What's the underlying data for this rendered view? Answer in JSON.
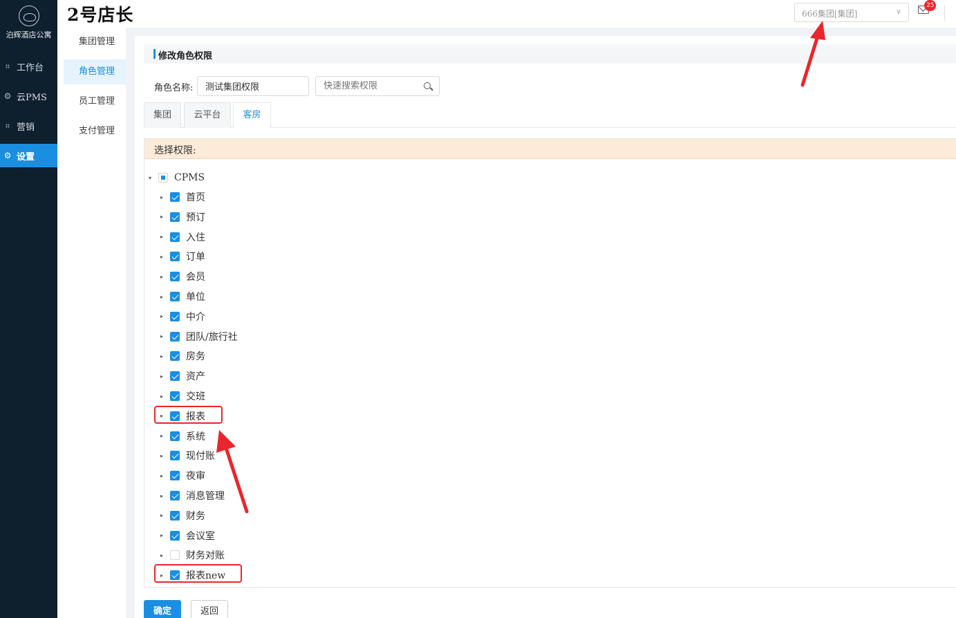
{
  "logo": {
    "text": "泊辉酒店公寓"
  },
  "app_title": "2号店长",
  "nav": [
    {
      "label": "工作台",
      "icon": "workspace-icon"
    },
    {
      "label": "云PMS",
      "icon": "gear-icon"
    },
    {
      "label": "营销",
      "icon": "marketing-icon"
    },
    {
      "label": "设置",
      "icon": "gear-icon",
      "active": true
    }
  ],
  "header": {
    "group_select_value": "666集团[集团]",
    "mail_count": "25"
  },
  "submenu": [
    {
      "label": "集团管理"
    },
    {
      "label": "角色管理",
      "active": true
    },
    {
      "label": "员工管理"
    },
    {
      "label": "支付管理"
    }
  ],
  "panel": {
    "title": "修改角色权限",
    "role_label": "角色名称:",
    "role_value": "测试集团权限",
    "search_placeholder": "快速搜索权限"
  },
  "tabs": [
    {
      "label": "集团"
    },
    {
      "label": "云平台"
    },
    {
      "label": "客房",
      "active": true
    }
  ],
  "permissions": {
    "header": "选择权限:",
    "root": {
      "label": "CPMS",
      "state": "partial"
    },
    "items": [
      {
        "label": "首页",
        "checked": true
      },
      {
        "label": "预订",
        "checked": true
      },
      {
        "label": "入住",
        "checked": true
      },
      {
        "label": "订单",
        "checked": true
      },
      {
        "label": "会员",
        "checked": true
      },
      {
        "label": "单位",
        "checked": true
      },
      {
        "label": "中介",
        "checked": true
      },
      {
        "label": "团队/旅行社",
        "checked": true
      },
      {
        "label": "房务",
        "checked": true
      },
      {
        "label": "资产",
        "checked": true
      },
      {
        "label": "交班",
        "checked": true
      },
      {
        "label": "报表",
        "checked": true,
        "highlighted": true
      },
      {
        "label": "系统",
        "checked": true
      },
      {
        "label": "现付账",
        "checked": true
      },
      {
        "label": "夜审",
        "checked": true
      },
      {
        "label": "消息管理",
        "checked": true
      },
      {
        "label": "财务",
        "checked": true
      },
      {
        "label": "会议室",
        "checked": true
      },
      {
        "label": "财务对账",
        "checked": false
      },
      {
        "label": "报表new",
        "checked": true,
        "highlighted": true
      }
    ]
  },
  "buttons": {
    "ok": "确定",
    "back": "返回"
  },
  "colors": {
    "accent": "#1a8ee0",
    "sidebar": "#0e1f2e",
    "annotation": "#e8262c"
  }
}
